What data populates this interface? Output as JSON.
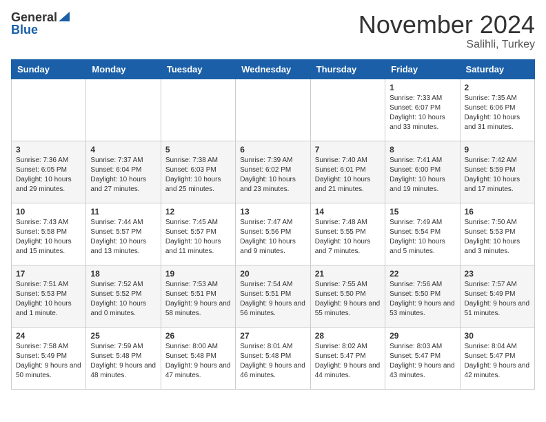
{
  "header": {
    "logo_general": "General",
    "logo_blue": "Blue",
    "month_title": "November 2024",
    "location": "Salihli, Turkey"
  },
  "weekdays": [
    "Sunday",
    "Monday",
    "Tuesday",
    "Wednesday",
    "Thursday",
    "Friday",
    "Saturday"
  ],
  "weeks": [
    [
      {
        "day": "",
        "info": ""
      },
      {
        "day": "",
        "info": ""
      },
      {
        "day": "",
        "info": ""
      },
      {
        "day": "",
        "info": ""
      },
      {
        "day": "",
        "info": ""
      },
      {
        "day": "1",
        "info": "Sunrise: 7:33 AM\nSunset: 6:07 PM\nDaylight: 10 hours and 33 minutes."
      },
      {
        "day": "2",
        "info": "Sunrise: 7:35 AM\nSunset: 6:06 PM\nDaylight: 10 hours and 31 minutes."
      }
    ],
    [
      {
        "day": "3",
        "info": "Sunrise: 7:36 AM\nSunset: 6:05 PM\nDaylight: 10 hours and 29 minutes."
      },
      {
        "day": "4",
        "info": "Sunrise: 7:37 AM\nSunset: 6:04 PM\nDaylight: 10 hours and 27 minutes."
      },
      {
        "day": "5",
        "info": "Sunrise: 7:38 AM\nSunset: 6:03 PM\nDaylight: 10 hours and 25 minutes."
      },
      {
        "day": "6",
        "info": "Sunrise: 7:39 AM\nSunset: 6:02 PM\nDaylight: 10 hours and 23 minutes."
      },
      {
        "day": "7",
        "info": "Sunrise: 7:40 AM\nSunset: 6:01 PM\nDaylight: 10 hours and 21 minutes."
      },
      {
        "day": "8",
        "info": "Sunrise: 7:41 AM\nSunset: 6:00 PM\nDaylight: 10 hours and 19 minutes."
      },
      {
        "day": "9",
        "info": "Sunrise: 7:42 AM\nSunset: 5:59 PM\nDaylight: 10 hours and 17 minutes."
      }
    ],
    [
      {
        "day": "10",
        "info": "Sunrise: 7:43 AM\nSunset: 5:58 PM\nDaylight: 10 hours and 15 minutes."
      },
      {
        "day": "11",
        "info": "Sunrise: 7:44 AM\nSunset: 5:57 PM\nDaylight: 10 hours and 13 minutes."
      },
      {
        "day": "12",
        "info": "Sunrise: 7:45 AM\nSunset: 5:57 PM\nDaylight: 10 hours and 11 minutes."
      },
      {
        "day": "13",
        "info": "Sunrise: 7:47 AM\nSunset: 5:56 PM\nDaylight: 10 hours and 9 minutes."
      },
      {
        "day": "14",
        "info": "Sunrise: 7:48 AM\nSunset: 5:55 PM\nDaylight: 10 hours and 7 minutes."
      },
      {
        "day": "15",
        "info": "Sunrise: 7:49 AM\nSunset: 5:54 PM\nDaylight: 10 hours and 5 minutes."
      },
      {
        "day": "16",
        "info": "Sunrise: 7:50 AM\nSunset: 5:53 PM\nDaylight: 10 hours and 3 minutes."
      }
    ],
    [
      {
        "day": "17",
        "info": "Sunrise: 7:51 AM\nSunset: 5:53 PM\nDaylight: 10 hours and 1 minute."
      },
      {
        "day": "18",
        "info": "Sunrise: 7:52 AM\nSunset: 5:52 PM\nDaylight: 10 hours and 0 minutes."
      },
      {
        "day": "19",
        "info": "Sunrise: 7:53 AM\nSunset: 5:51 PM\nDaylight: 9 hours and 58 minutes."
      },
      {
        "day": "20",
        "info": "Sunrise: 7:54 AM\nSunset: 5:51 PM\nDaylight: 9 hours and 56 minutes."
      },
      {
        "day": "21",
        "info": "Sunrise: 7:55 AM\nSunset: 5:50 PM\nDaylight: 9 hours and 55 minutes."
      },
      {
        "day": "22",
        "info": "Sunrise: 7:56 AM\nSunset: 5:50 PM\nDaylight: 9 hours and 53 minutes."
      },
      {
        "day": "23",
        "info": "Sunrise: 7:57 AM\nSunset: 5:49 PM\nDaylight: 9 hours and 51 minutes."
      }
    ],
    [
      {
        "day": "24",
        "info": "Sunrise: 7:58 AM\nSunset: 5:49 PM\nDaylight: 9 hours and 50 minutes."
      },
      {
        "day": "25",
        "info": "Sunrise: 7:59 AM\nSunset: 5:48 PM\nDaylight: 9 hours and 48 minutes."
      },
      {
        "day": "26",
        "info": "Sunrise: 8:00 AM\nSunset: 5:48 PM\nDaylight: 9 hours and 47 minutes."
      },
      {
        "day": "27",
        "info": "Sunrise: 8:01 AM\nSunset: 5:48 PM\nDaylight: 9 hours and 46 minutes."
      },
      {
        "day": "28",
        "info": "Sunrise: 8:02 AM\nSunset: 5:47 PM\nDaylight: 9 hours and 44 minutes."
      },
      {
        "day": "29",
        "info": "Sunrise: 8:03 AM\nSunset: 5:47 PM\nDaylight: 9 hours and 43 minutes."
      },
      {
        "day": "30",
        "info": "Sunrise: 8:04 AM\nSunset: 5:47 PM\nDaylight: 9 hours and 42 minutes."
      }
    ]
  ]
}
